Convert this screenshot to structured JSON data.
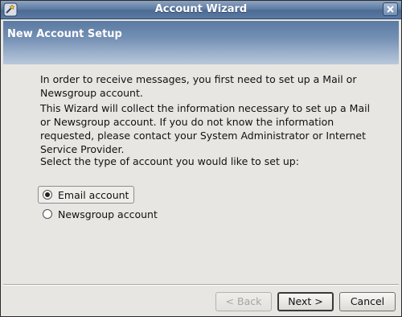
{
  "window": {
    "title": "Account Wizard",
    "icon": "wizard-app-icon",
    "close_icon": "close-icon"
  },
  "banner": {
    "title": "New Account Setup"
  },
  "content": {
    "intro": "In order to receive messages, you first need to set up a Mail or Newsgroup account.",
    "info": "This Wizard will collect the information necessary to set up a Mail or Newsgroup account. If you do not know the information requested, please contact your System Administrator or Internet Service Provider.",
    "prompt": "Select the type of account you would like to set up:",
    "options": [
      {
        "label": "Email account",
        "selected": true
      },
      {
        "label": "Newsgroup account",
        "selected": false
      }
    ]
  },
  "buttons": {
    "back": "< Back",
    "next": "Next >",
    "cancel": "Cancel"
  },
  "colors": {
    "titlebar": "#5f7da4",
    "banner_top": "#5b7aa2",
    "banner_bottom": "#b9c8db",
    "background": "#e7e6e2"
  }
}
